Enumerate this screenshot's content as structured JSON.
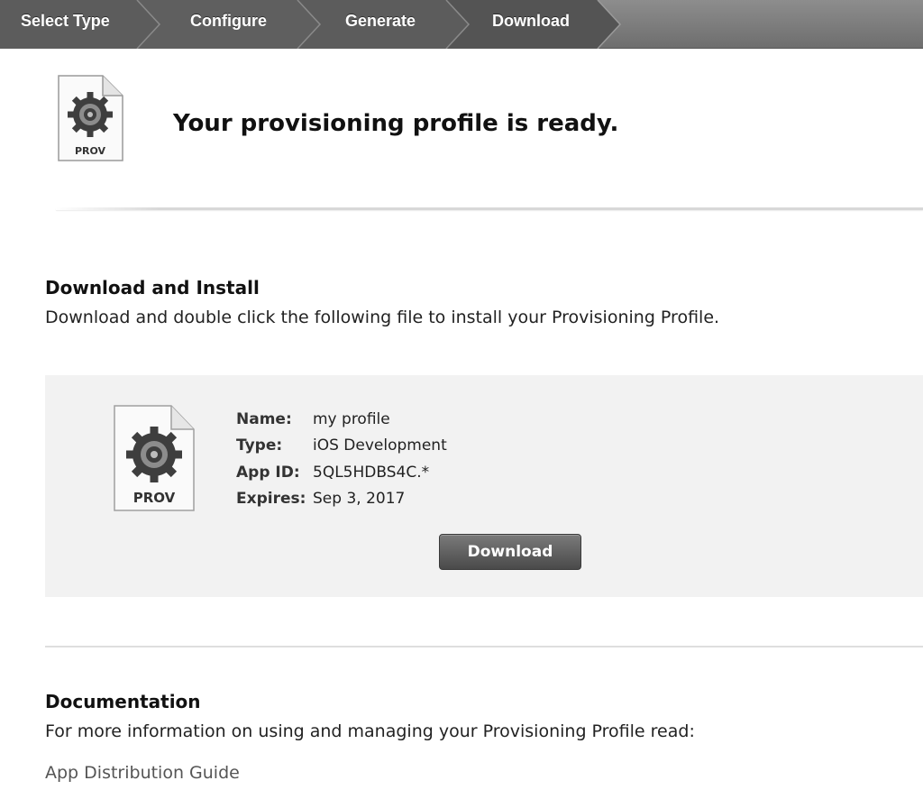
{
  "steps": [
    {
      "label": "Select Type"
    },
    {
      "label": "Configure"
    },
    {
      "label": "Generate"
    },
    {
      "label": "Download"
    }
  ],
  "header": {
    "icon_label": "PROV",
    "title": "Your provisioning profile is ready."
  },
  "download_section": {
    "heading": "Download and Install",
    "description": "Download and double click the following file to install your Provisioning Profile."
  },
  "profile": {
    "icon_label": "PROV",
    "fields": [
      {
        "key": "Name:",
        "value": "my profile"
      },
      {
        "key": "Type:",
        "value": "iOS Development"
      },
      {
        "key": "App ID:",
        "value": "5QL5HDBS4C.*"
      },
      {
        "key": "Expires:",
        "value": "Sep 3, 2017"
      }
    ],
    "download_label": "Download"
  },
  "documentation": {
    "heading": "Documentation",
    "description": "For more information on using and managing your Provisioning Profile read:",
    "link_label": "App Distribution Guide"
  },
  "colors": {
    "stepbar": "#7d7d7d",
    "panel": "#f2f2f2",
    "button": "#555555"
  }
}
